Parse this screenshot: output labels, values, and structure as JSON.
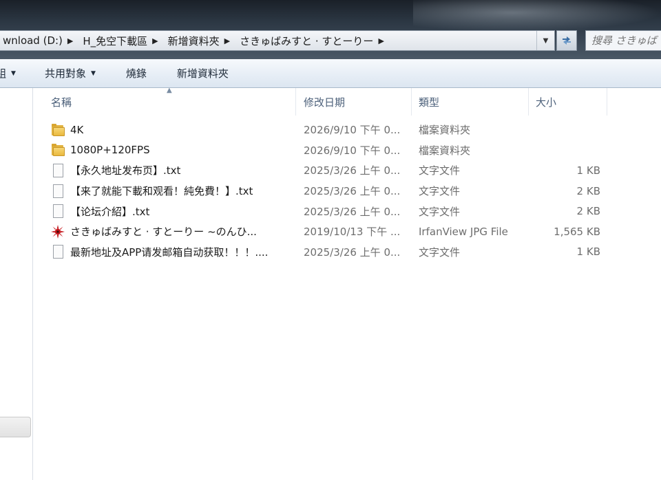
{
  "address_bar": {
    "breadcrumbs": [
      "wnload (D:)",
      "H_免空下載區",
      "新增資料夾",
      "さきゅばみすと · すとーりー"
    ],
    "search_placeholder": "搜尋 さきゅば"
  },
  "command_bar": {
    "items": [
      {
        "label": "組",
        "has_dropdown": true
      },
      {
        "label": "共用對象",
        "has_dropdown": true
      },
      {
        "label": "燒錄",
        "has_dropdown": false
      },
      {
        "label": "新增資料夾",
        "has_dropdown": false
      }
    ]
  },
  "columns": {
    "name": "名稱",
    "date": "修改日期",
    "type": "類型",
    "size": "大小"
  },
  "files": [
    {
      "name": "4K",
      "date": "2026/9/10 下午 0...",
      "type": "檔案資料夾",
      "size": "",
      "icon": "folder-icon"
    },
    {
      "name": "1080P+120FPS",
      "date": "2026/9/10 下午 0...",
      "type": "檔案資料夾",
      "size": "",
      "icon": "folder-icon"
    },
    {
      "name": "【永久地址发布页】.txt",
      "date": "2025/3/26 上午 0...",
      "type": "文字文件",
      "size": "1 KB",
      "icon": "text-file-icon"
    },
    {
      "name": "【来了就能下載和观看！純免費！】.txt",
      "date": "2025/3/26 上午 0...",
      "type": "文字文件",
      "size": "2 KB",
      "icon": "text-file-icon"
    },
    {
      "name": "【论坛介紹】.txt",
      "date": "2025/3/26 上午 0...",
      "type": "文字文件",
      "size": "2 KB",
      "icon": "text-file-icon"
    },
    {
      "name": "さきゅばみすと · すとーりー ~のんひ...",
      "date": "2019/10/13 下午 ...",
      "type": "IrfanView JPG File",
      "size": "1,565 KB",
      "icon": "irfanview-image-icon"
    },
    {
      "name": "最新地址及APP请发邮箱自动获取！！！....",
      "date": "2025/3/26 上午 0...",
      "type": "文字文件",
      "size": "1 KB",
      "icon": "text-file-icon"
    }
  ]
}
